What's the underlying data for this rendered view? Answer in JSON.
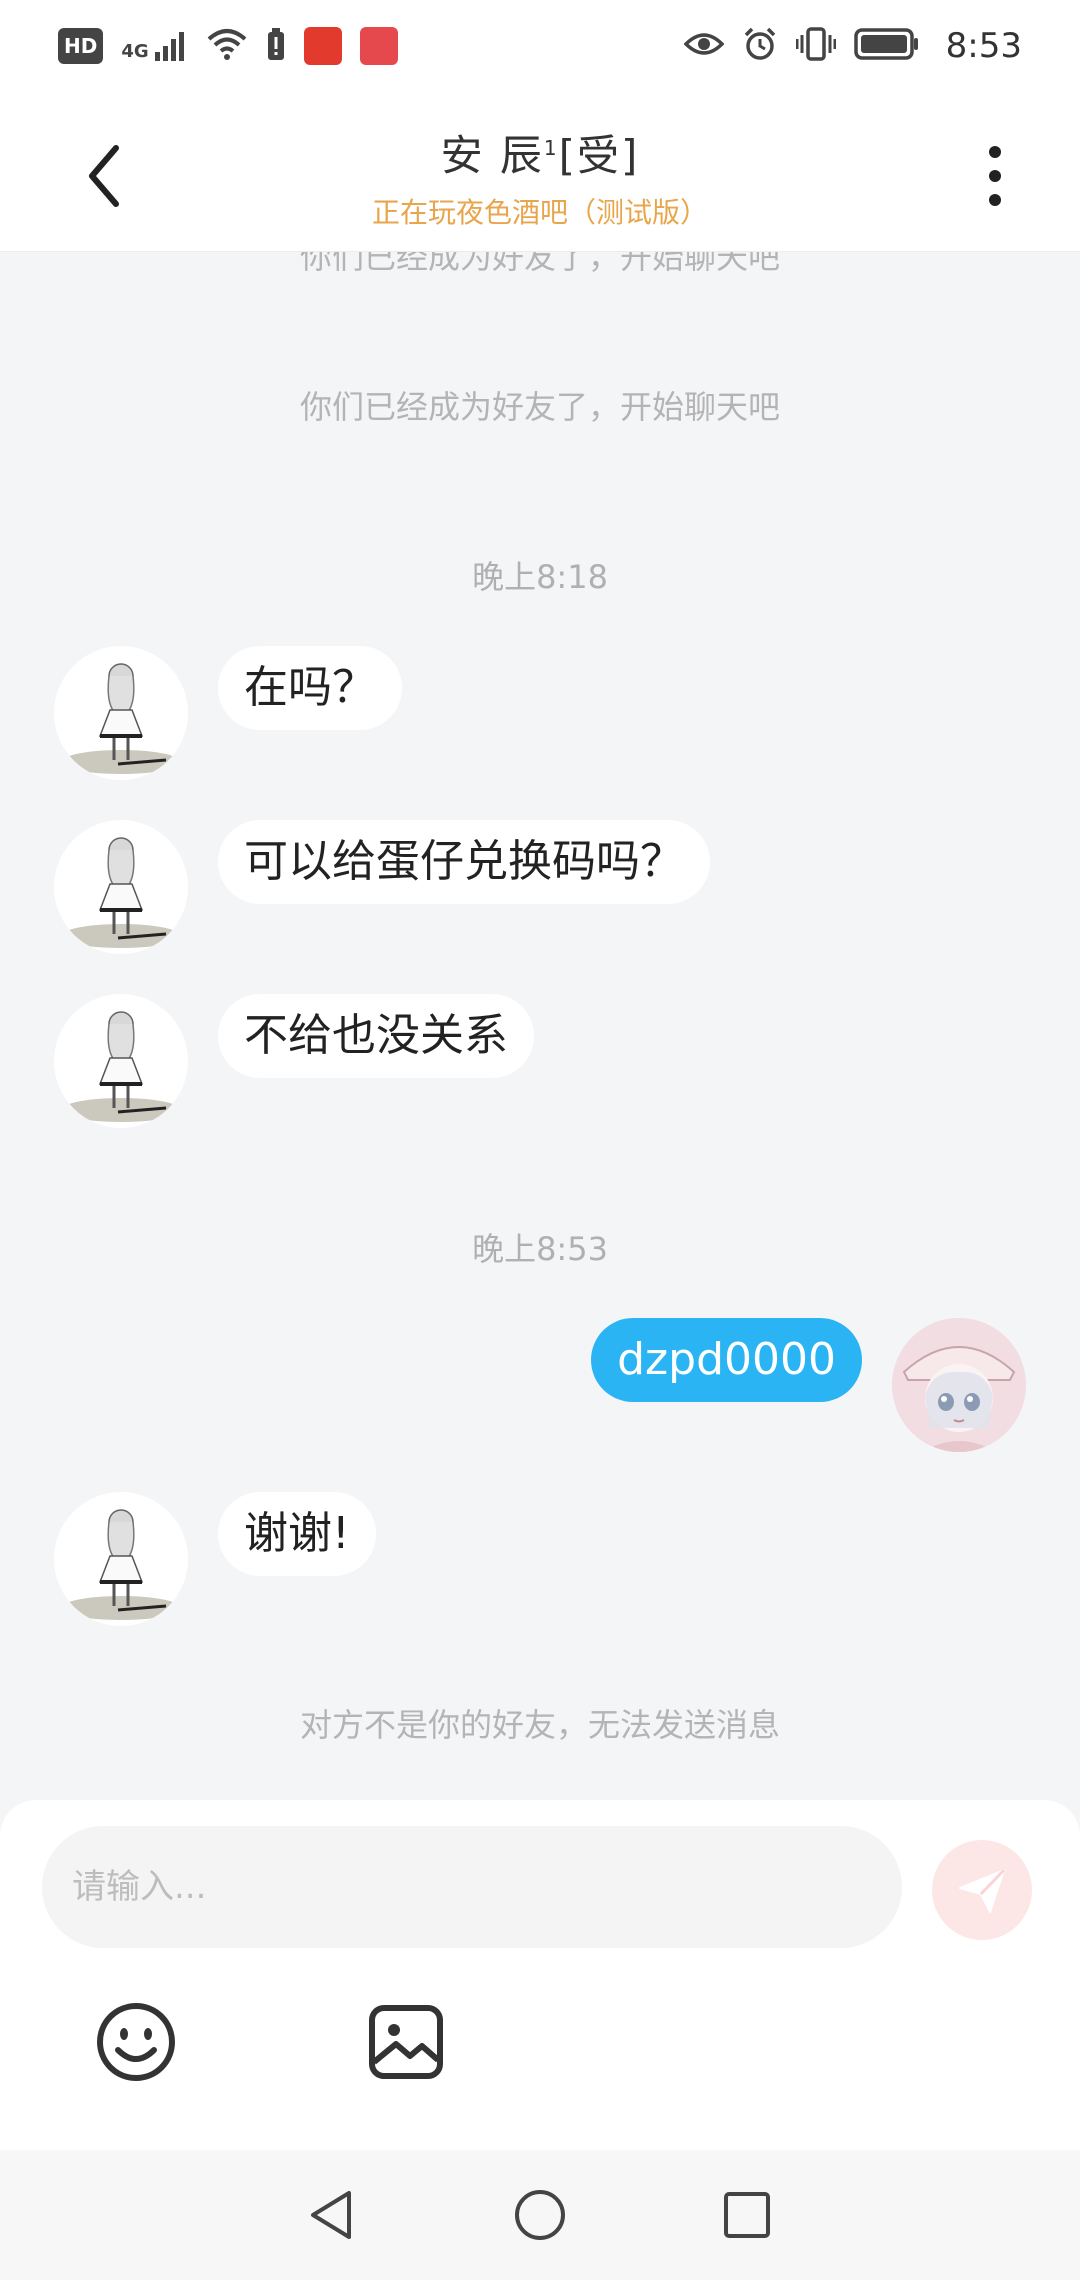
{
  "status_bar": {
    "hd_label": "HD",
    "network_label": "4G",
    "time": "8:53",
    "icons": [
      "hd-badge",
      "signal-icon",
      "wifi-icon",
      "battery-saver-icon",
      "app-notification-icon",
      "huawei-app-icon",
      "eye-icon",
      "alarm-icon",
      "vibrate-icon",
      "battery-icon"
    ]
  },
  "header": {
    "title": "安 辰",
    "title_sup": "1",
    "title_tag": "[受]",
    "subtitle": "正在玩夜色酒吧（测试版）",
    "subtitle_color": "#e8a54b",
    "back_icon": "chevron-left-icon",
    "more_icon": "more-vertical-icon"
  },
  "messages": {
    "system_partial": "你们已经成为好友了，开始聊天吧",
    "system_friends": "你们已经成为好友了，开始聊天吧",
    "time_1": "晚上8:18",
    "msg_1": "在吗？",
    "msg_2": "可以给蛋仔兑换码吗？",
    "msg_3": "不给也没关系",
    "time_2": "晚上8:53",
    "msg_4": "dzpd0000",
    "msg_5": "谢谢!",
    "system_not_friend": "对方不是你的好友，无法发送消息",
    "self_bubble_color": "#2bb4f3"
  },
  "input_panel": {
    "placeholder": "请输入...",
    "send_icon": "send-icon",
    "emoji_icon": "emoji-icon",
    "image_icon": "image-icon"
  },
  "nav_bar": {
    "icons": [
      "nav-back-icon",
      "nav-home-icon",
      "nav-recents-icon"
    ]
  }
}
